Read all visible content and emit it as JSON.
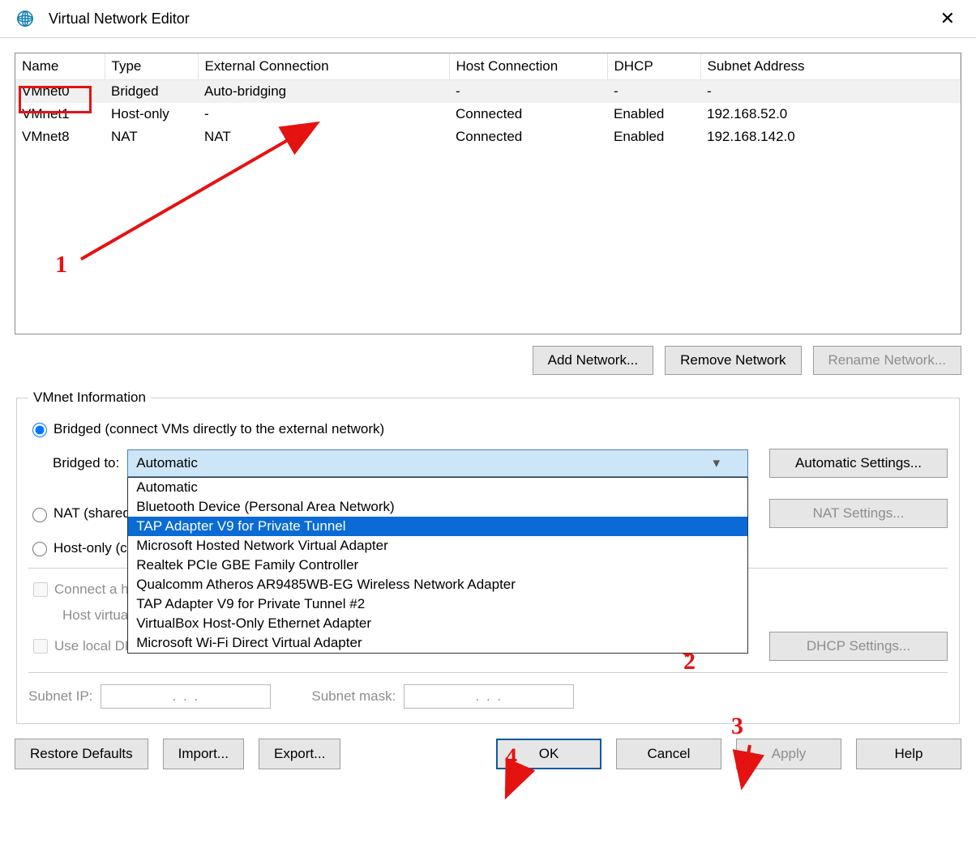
{
  "window": {
    "title": "Virtual Network Editor"
  },
  "table": {
    "headers": [
      "Name",
      "Type",
      "External Connection",
      "Host Connection",
      "DHCP",
      "Subnet Address"
    ],
    "rows": [
      {
        "name": "VMnet0",
        "type": "Bridged",
        "ext": "Auto-bridging",
        "host": "-",
        "dhcp": "-",
        "subnet": "-",
        "selected": true
      },
      {
        "name": "VMnet1",
        "type": "Host-only",
        "ext": "-",
        "host": "Connected",
        "dhcp": "Enabled",
        "subnet": "192.168.52.0"
      },
      {
        "name": "VMnet8",
        "type": "NAT",
        "ext": "NAT",
        "host": "Connected",
        "dhcp": "Enabled",
        "subnet": "192.168.142.0"
      }
    ]
  },
  "table_buttons": {
    "add": "Add Network...",
    "remove": "Remove Network",
    "rename": "Rename Network..."
  },
  "group": {
    "legend": "VMnet Information",
    "bridged_label": "Bridged (connect VMs directly to the external network)",
    "bridged_to": "Bridged to:",
    "auto_settings": "Automatic Settings...",
    "nat_label": "NAT (shared",
    "nat_settings": "NAT Settings...",
    "hostonly_label": "Host-only (c",
    "connect_host": "Connect a h",
    "host_virtual": "Host virtual",
    "use_local_dhcp": "Use local DH",
    "dhcp_settings": "DHCP Settings...",
    "subnet_ip": "Subnet IP:",
    "subnet_mask": "Subnet mask:",
    "ip_dots": ".        .        ."
  },
  "combo": {
    "value": "Automatic",
    "options": [
      "Automatic",
      "Bluetooth Device (Personal Area Network)",
      "TAP Adapter V9 for Private Tunnel",
      "Microsoft Hosted Network Virtual Adapter",
      "Realtek PCIe GBE Family Controller",
      "Qualcomm Atheros AR9485WB-EG Wireless Network Adapter",
      "TAP Adapter V9 for Private Tunnel #2",
      "VirtualBox Host-Only Ethernet Adapter",
      "Microsoft Wi-Fi Direct Virtual Adapter"
    ],
    "highlight_index": 2
  },
  "footer": {
    "restore": "Restore Defaults",
    "import": "Import...",
    "export": "Export...",
    "ok": "OK",
    "cancel": "Cancel",
    "apply": "Apply",
    "help": "Help"
  },
  "annotations": {
    "n1": "1",
    "n2": "2",
    "n3": "3",
    "n4": "4"
  }
}
